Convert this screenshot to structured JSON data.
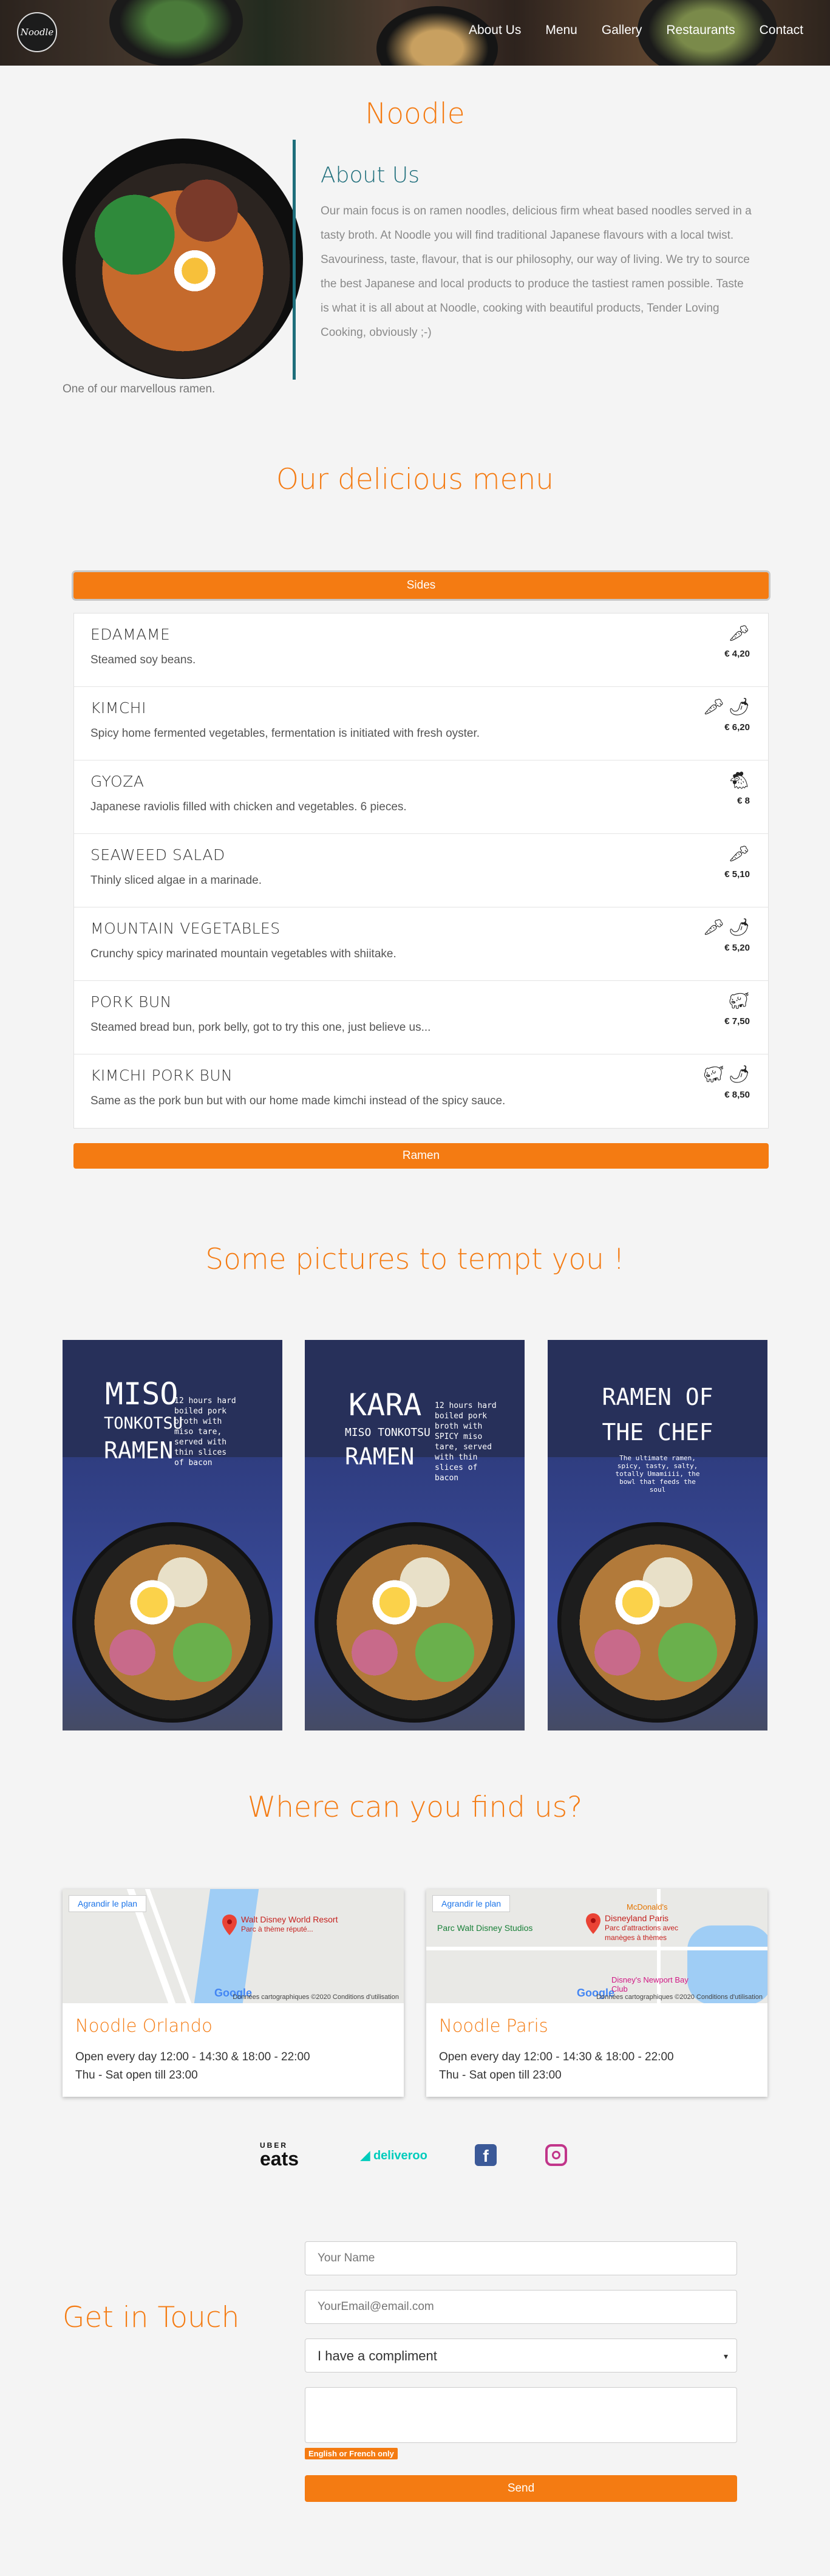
{
  "header": {
    "logo_text": "Noodle",
    "nav": [
      "About Us",
      "Menu",
      "Gallery",
      "Restaurants",
      "Contact"
    ]
  },
  "site_title": "Noodle",
  "about": {
    "title": "About Us",
    "text": "Our main focus is on ramen noodles, delicious firm wheat based noodles served in a tasty broth. At Noodle you will find traditional Japanese flavours with a local twist. Savouriness, taste, flavour, that is our philosophy, our way of living. We try to source the best Japanese and local products to produce the tastiest ramen possible. Taste is what it is all about at Noodle, cooking with beautiful products, Tender Loving Cooking, obviously ;-)",
    "caption": "One of our marvellous ramen."
  },
  "menu": {
    "title": "Our delicious menu",
    "tabs": [
      "Sides",
      "Ramen"
    ],
    "items": [
      {
        "name": "EDAMAME",
        "desc": "Steamed soy beans.",
        "price": "€ 4,20",
        "icons": [
          "veggie-icon"
        ]
      },
      {
        "name": "KIMCHI",
        "desc": "Spicy home fermented vegetables, fermentation is initiated with fresh oyster.",
        "price": "€ 6,20",
        "icons": [
          "veggie-icon",
          "chili-icon"
        ]
      },
      {
        "name": "GYOZA",
        "desc": "Japanese raviolis filled with chicken and vegetables. 6 pieces.",
        "price": "€ 8",
        "icons": [
          "chicken-icon"
        ]
      },
      {
        "name": "SEAWEED SALAD",
        "desc": "Thinly sliced algae in a marinade.",
        "price": "€ 5,10",
        "icons": [
          "veggie-icon"
        ]
      },
      {
        "name": "MOUNTAIN VEGETABLES",
        "desc": "Crunchy spicy marinated mountain vegetables with shiitake.",
        "price": "€ 5,20",
        "icons": [
          "veggie-icon",
          "chili-icon"
        ]
      },
      {
        "name": "PORK BUN",
        "desc": "Steamed bread bun, pork belly, got to try this one, just believe us...",
        "price": "€ 7,50",
        "icons": [
          "pork-icon"
        ]
      },
      {
        "name": "KIMCHI PORK BUN",
        "desc": "Same as the pork bun but with our home made kimchi instead of the spicy sauce.",
        "price": "€ 8,50",
        "icons": [
          "pork-icon",
          "chili-icon"
        ]
      }
    ]
  },
  "gallery": {
    "title": "Some pictures to tempt you !",
    "posters": [
      {
        "line1": "MISO",
        "line2": "TONKOTSU",
        "line3": "RAMEN",
        "blurb": [
          "12 hours hard",
          "boiled pork",
          "broth with",
          "miso tare,",
          "served with",
          "thin slices",
          "of bacon"
        ]
      },
      {
        "line1": "KARA",
        "line2": "MISO TONKOTSU",
        "line3": "RAMEN",
        "blurb": [
          "12 hours hard",
          "boiled pork",
          "broth with",
          "SPICY miso",
          "tare, served",
          "with thin",
          "slices of",
          "bacon"
        ]
      },
      {
        "line1": "RAMEN OF",
        "line2": "THE CHEF",
        "line3": "",
        "blurb": [
          "The ultimate ramen,",
          "spicy, tasty, salty,",
          "totally Umamiiii, the",
          "bowl that feeds the",
          "soul"
        ]
      }
    ]
  },
  "locations": {
    "title": "Where can you find us?",
    "map_button": "Agrandir le plan",
    "map_footer": "Données cartographiques ©2020    Conditions d'utilisation",
    "google": "Google",
    "cards": [
      {
        "name": "Noodle Orlando",
        "hours1": "Open every day 12:00 - 14:30 & 18:00 - 22:00",
        "hours2": "Thu - Sat open till 23:00",
        "pin_title": "Walt Disney World Resort",
        "pin_sub": "Parc à thème réputé..."
      },
      {
        "name": "Noodle Paris",
        "hours1": "Open every day 12:00 - 14:30 & 18:00 - 22:00",
        "hours2": "Thu - Sat open till 23:00",
        "pin_title": "Disneyland Paris",
        "pin_sub": "Parc d'attractions avec manèges à thèmes",
        "extra_labels": [
          "Parc Walt Disney Studios",
          "McDonald's",
          "Disney's Newport Bay Club"
        ]
      }
    ]
  },
  "partners": {
    "ubereats_top": "UBER",
    "ubereats_bottom": "eats",
    "deliveroo": "deliveroo"
  },
  "contact": {
    "title": "Get in Touch",
    "name_placeholder": "Your Name",
    "email_placeholder": "YourEmail@email.com",
    "subject_value": "I have a compliment",
    "note": "English or French only",
    "send": "Send"
  },
  "colors": {
    "accent": "#f47b12",
    "teal": "#1e6e7b",
    "background": "#f4f4f4"
  }
}
